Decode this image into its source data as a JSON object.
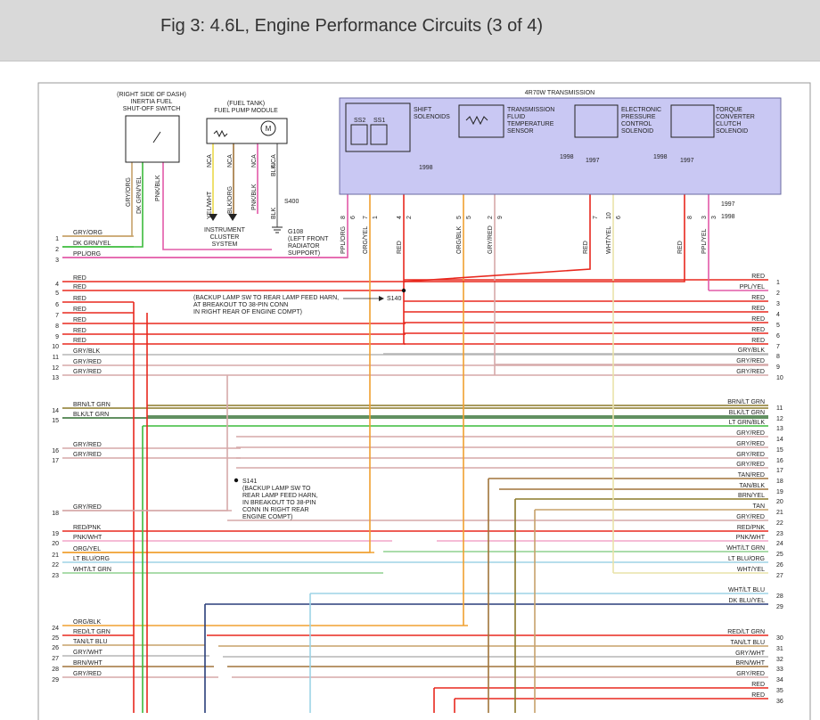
{
  "header": {
    "title": "Fig 3: 4.6L, Engine Performance Circuits (3 of 4)"
  },
  "components": {
    "inertia": [
      "(RIGHT SIDE OF DASH)",
      "INERTIA FUEL",
      "SHUT-OFF SWITCH"
    ],
    "fuel_pump": [
      "(FUEL TANK)",
      "FUEL PUMP MODULE"
    ],
    "transmission": "4R70W TRANSMISSION",
    "shift_solenoids": [
      "SHIFT",
      "SOLENOIDS"
    ],
    "ss2": "SS2",
    "ss1": "SS1",
    "tft": [
      "TRANSMISSION",
      "FLUID",
      "TEMPERATURE",
      "SENSOR"
    ],
    "epc": [
      "ELECTRONIC",
      "PRESSURE",
      "CONTROL",
      "SOLENOID"
    ],
    "tcc": [
      "TORQUE",
      "CONVERTER",
      "CLUTCH",
      "SOLENOID"
    ],
    "motor": "M",
    "cluster": [
      "INSTRUMENT",
      "CLUSTER",
      "SYSTEM"
    ],
    "g108": [
      "G108",
      "(LEFT FRONT",
      "RADIATOR",
      "SUPPORT)"
    ],
    "s400": "S400",
    "s140_note": [
      "(BACKUP LAMP SW TO REAR LAMP FEED HARN,",
      "AT BREAKOUT TO 38-PIN CONN",
      "IN RIGHT REAR OF ENGINE COMPT)"
    ],
    "s140": "S140",
    "s141": "S141",
    "s141_note": [
      "(BACKUP LAMP SW TO",
      "REAR LAMP FEED HARN,",
      "IN BREAKOUT TO 38-PIN",
      "CONN IN RIGHT REAR",
      "ENGINE COMPT)"
    ],
    "year_1998": "1998",
    "year_1997": "1997"
  },
  "top_wire_labels": [
    "GRY/ORG",
    "DK GRN/YEL",
    "PNK/BLK",
    "YEL/WHT",
    "BLK/ORG",
    "PNK/BLK",
    "BLK",
    "BLK",
    "NCA",
    "NCA",
    "NCA",
    "NCA"
  ],
  "trans_pins": [
    {
      "pin": "8",
      "cav": "6",
      "color": "PPL/ORG"
    },
    {
      "pin": "7",
      "cav": "1",
      "color": "ORG/YEL"
    },
    {
      "pin": "4",
      "cav": "2",
      "color": "RED"
    },
    {
      "pin": "5",
      "cav": "5",
      "color": "ORG/BLK"
    },
    {
      "pin": "2",
      "cav": "9",
      "color": "GRY/RED"
    },
    {
      "pin": "",
      "cav": "7",
      "color": "RED"
    },
    {
      "pin": "10",
      "cav": "6",
      "color": "WHT/YEL"
    },
    {
      "pin": "",
      "cav": "8",
      "color": "RED"
    },
    {
      "pin": "3",
      "cav": "3",
      "color": "PPL/YEL"
    }
  ],
  "left_rows": [
    {
      "num": "1",
      "label": "GRY/ORG"
    },
    {
      "num": "2",
      "label": "DK GRN/YEL"
    },
    {
      "num": "3",
      "label": "PPL/ORG"
    },
    {
      "num": "4",
      "label": "RED"
    },
    {
      "num": "5",
      "label": "RED"
    },
    {
      "num": "6",
      "label": "RED"
    },
    {
      "num": "7",
      "label": "RED"
    },
    {
      "num": "8",
      "label": "RED"
    },
    {
      "num": "9",
      "label": "RED"
    },
    {
      "num": "10",
      "label": "RED"
    },
    {
      "num": "11",
      "label": "GRY/BLK"
    },
    {
      "num": "12",
      "label": "GRY/RED"
    },
    {
      "num": "13",
      "label": "GRY/RED"
    },
    {
      "num": "14",
      "label": "BRN/LT GRN"
    },
    {
      "num": "15",
      "label": "BLK/LT GRN"
    },
    {
      "num": "16",
      "label": "GRY/RED"
    },
    {
      "num": "17",
      "label": "GRY/RED"
    },
    {
      "num": "18",
      "label": "GRY/RED"
    },
    {
      "num": "19",
      "label": "RED/PNK"
    },
    {
      "num": "20",
      "label": "PNK/WHT"
    },
    {
      "num": "21",
      "label": "ORG/YEL"
    },
    {
      "num": "22",
      "label": "LT BLU/ORG"
    },
    {
      "num": "23",
      "label": "WHT/LT GRN"
    },
    {
      "num": "24",
      "label": "ORG/BLK"
    },
    {
      "num": "25",
      "label": "RED/LT GRN"
    },
    {
      "num": "26",
      "label": "TAN/LT BLU"
    },
    {
      "num": "27",
      "label": "GRY/WHT"
    },
    {
      "num": "28",
      "label": "BRN/WHT"
    },
    {
      "num": "29",
      "label": "GRY/RED"
    }
  ],
  "right_rows": [
    {
      "num": "1",
      "label": "RED"
    },
    {
      "num": "2",
      "label": "PPL/YEL"
    },
    {
      "num": "3",
      "label": "RED"
    },
    {
      "num": "4",
      "label": "RED"
    },
    {
      "num": "5",
      "label": "RED"
    },
    {
      "num": "6",
      "label": "RED"
    },
    {
      "num": "7",
      "label": "RED"
    },
    {
      "num": "8",
      "label": "GRY/BLK"
    },
    {
      "num": "9",
      "label": "GRY/RED"
    },
    {
      "num": "10",
      "label": "GRY/RED"
    },
    {
      "num": "11",
      "label": "BRN/LT GRN"
    },
    {
      "num": "12",
      "label": "BLK/LT GRN"
    },
    {
      "num": "13",
      "label": "LT GRN/BLK"
    },
    {
      "num": "14",
      "label": "GRY/RED"
    },
    {
      "num": "15",
      "label": "GRY/RED"
    },
    {
      "num": "16",
      "label": "GRY/RED"
    },
    {
      "num": "17",
      "label": "GRY/RED"
    },
    {
      "num": "18",
      "label": "TAN/RED"
    },
    {
      "num": "19",
      "label": "TAN/BLK"
    },
    {
      "num": "20",
      "label": "BRN/YEL"
    },
    {
      "num": "21",
      "label": "TAN"
    },
    {
      "num": "22",
      "label": "GRY/RED"
    },
    {
      "num": "23",
      "label": "RED/PNK"
    },
    {
      "num": "24",
      "label": "PNK/WHT"
    },
    {
      "num": "25",
      "label": "WHT/LT GRN"
    },
    {
      "num": "26",
      "label": "LT BLU/ORG"
    },
    {
      "num": "27",
      "label": "WHT/YEL"
    },
    {
      "num": "28",
      "label": "WHT/LT BLU"
    },
    {
      "num": "29",
      "label": "DK BLU/YEL"
    },
    {
      "num": "30",
      "label": "RED/LT GRN"
    },
    {
      "num": "31",
      "label": "TAN/LT BLU"
    },
    {
      "num": "32",
      "label": "GRY/WHT"
    },
    {
      "num": "33",
      "label": "BRN/WHT"
    },
    {
      "num": "34",
      "label": "GRY/RED"
    },
    {
      "num": "35",
      "label": "RED"
    },
    {
      "num": "36",
      "label": "RED"
    }
  ],
  "colors": {
    "red": "#e8281e",
    "gray": "#b5b5b5",
    "gray_red": "#d6a9a9",
    "pink": "#e25aa8",
    "orange": "#f0a030",
    "green": "#3cbb3c",
    "lt_green": "#8fd08f",
    "olive": "#8c7a2a",
    "brown": "#a0743a",
    "tan": "#c7a26a",
    "lt_blue": "#9dd3e6",
    "dk_blue": "#2a3f7a",
    "purple_fill": "#c9c8f3"
  }
}
